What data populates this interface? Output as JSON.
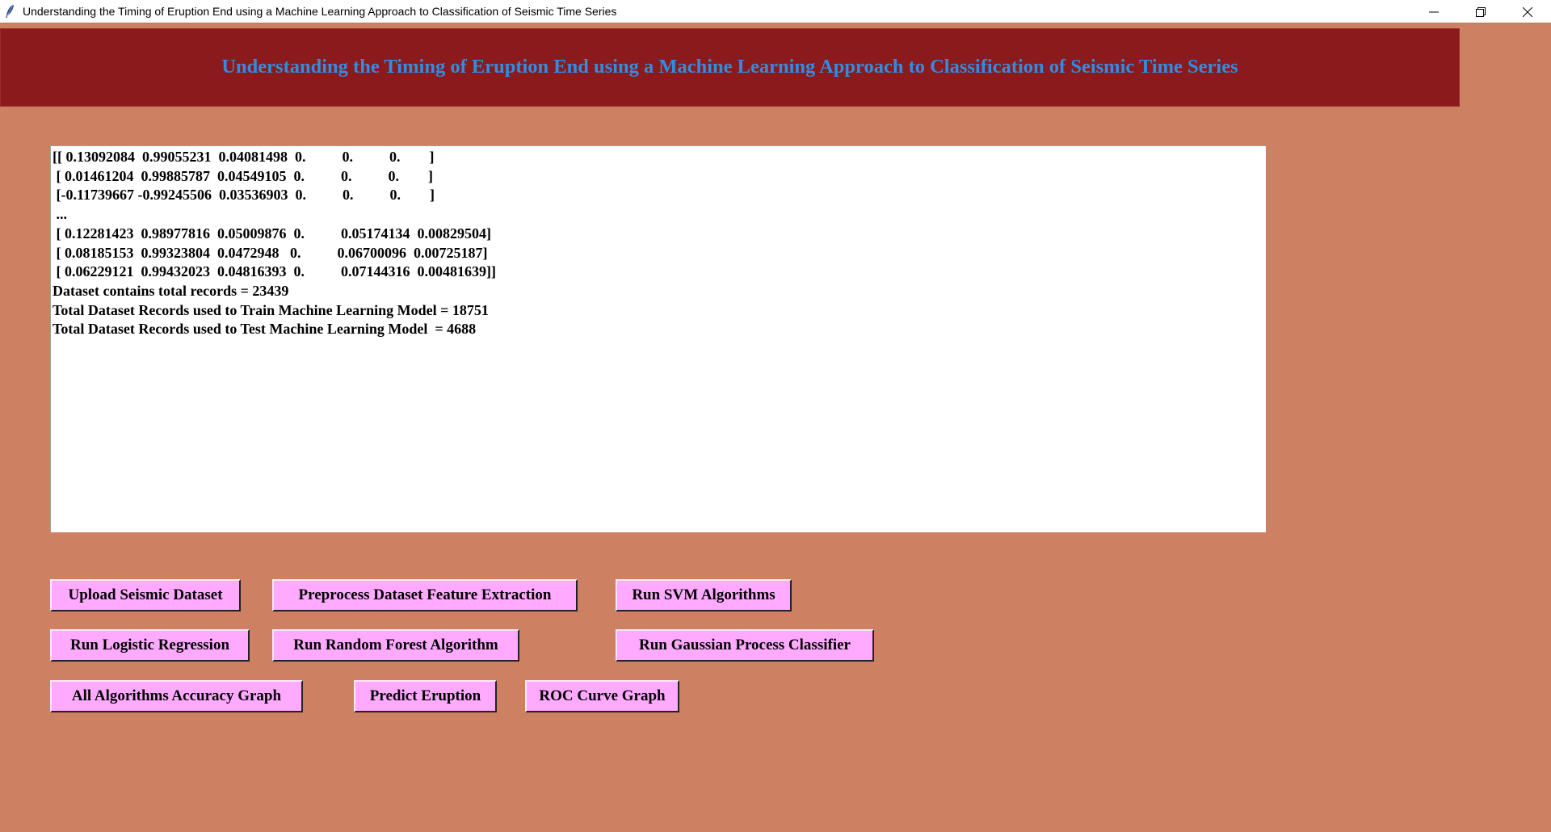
{
  "window": {
    "title": "Understanding the Timing of Eruption End using a Machine Learning Approach to Classification of Seismic Time Series",
    "icon": "feather-icon",
    "controls": [
      "minimize-icon",
      "restore-icon",
      "close-icon"
    ]
  },
  "header": {
    "title": "Understanding the Timing of Eruption End using a Machine Learning Approach to Classification of Seismic Time Series",
    "background": "#8b1a1c",
    "text_color": "#2f8de4"
  },
  "output": {
    "lines": [
      "[[ 0.13092084  0.99055231  0.04081498  0.          0.          0.        ]",
      " [ 0.01461204  0.99885787  0.04549105  0.          0.          0.        ]",
      " [-0.11739667 -0.99245506  0.03536903  0.          0.          0.        ]",
      " ...",
      " [ 0.12281423  0.98977816  0.05009876  0.          0.05174134  0.00829504]",
      " [ 0.08185153  0.99323804  0.0472948   0.          0.06700096  0.00725187]",
      " [ 0.06229121  0.99432023  0.04816393  0.          0.07144316  0.00481639]]",
      "Dataset contains total records = 23439",
      "Total Dataset Records used to Train Machine Learning Model = 18751",
      "Total Dataset Records used to Test Machine Learning Model  = 4688"
    ]
  },
  "buttons": {
    "upload": "Upload Seismic Dataset",
    "preprocess": "Preprocess Dataset Feature Extraction",
    "svm": "Run SVM Algorithms",
    "logistic": "Run Logistic Regression",
    "random_forest": "Run Random Forest Algorithm",
    "gaussian": "Run Gaussian Process Classifier",
    "accuracy_graph": "All Algorithms Accuracy Graph",
    "predict": "Predict Eruption",
    "roc": "ROC Curve Graph"
  },
  "colors": {
    "window_bg": "#ce8062",
    "button_bg": "#ffaaff"
  }
}
